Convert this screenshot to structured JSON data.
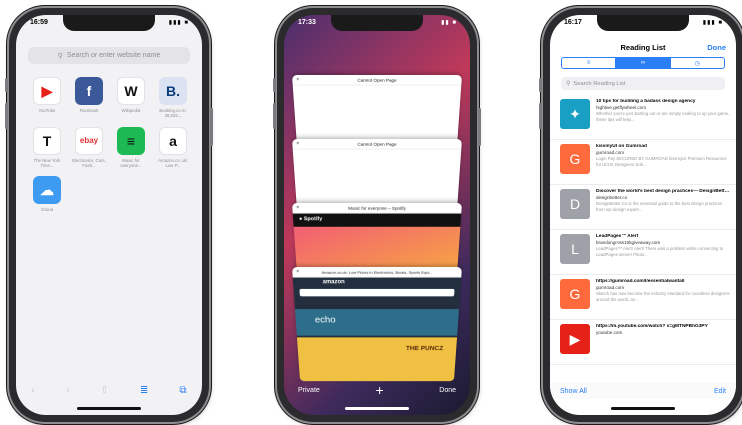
{
  "phone_favorites": {
    "time": "16:59",
    "status_icons": "▮▮▮ ■",
    "search_placeholder": "Search or enter website name",
    "favorites": [
      {
        "icon": "youtube-icon",
        "glyph": "▶",
        "bg": "#ffffff",
        "fg": "#e62117",
        "caption": "YouTube"
      },
      {
        "icon": "facebook-icon",
        "glyph": "f",
        "bg": "#3b5998",
        "fg": "#ffffff",
        "caption": "Facebook"
      },
      {
        "icon": "wikipedia-icon",
        "glyph": "W",
        "bg": "#ffffff",
        "fg": "#111111",
        "caption": "Wikipedia"
      },
      {
        "icon": "booking-icon",
        "glyph": "B.",
        "bg": "#dbe3f2",
        "fg": "#0c3b7c",
        "caption": "Booking.co m: 28,032..."
      },
      {
        "icon": "nytimes-icon",
        "glyph": "T",
        "bg": "#ffffff",
        "fg": "#111111",
        "caption": "The New York Time..."
      },
      {
        "icon": "ebay-icon",
        "glyph": "ebay",
        "bg": "#ffffff",
        "fg": "#e53238",
        "caption": "Electronics, Cars, Fash..."
      },
      {
        "icon": "spotify-icon",
        "glyph": "≡",
        "bg": "#1db954",
        "fg": "#111111",
        "caption": "Music for everyone..."
      },
      {
        "icon": "amazon-icon",
        "glyph": "a",
        "bg": "#ffffff",
        "fg": "#111111",
        "caption": "Amazon.co. uk: Low P..."
      },
      {
        "icon": "icloud-icon",
        "glyph": "☁",
        "bg": "#3d9bf2",
        "fg": "#ffffff",
        "caption": "iCloud"
      }
    ],
    "toolbar": [
      "‹",
      "›",
      "⇧",
      "≣",
      "⧉"
    ]
  },
  "phone_tabs": {
    "time": "17:33",
    "status_icons": "▮▮ ■",
    "tabs": [
      {
        "title": "Cannot Open Page",
        "close": "×",
        "body_color": "#ffffff"
      },
      {
        "title": "Cannot Open Page",
        "close": "×",
        "body_color": "#ffffff"
      },
      {
        "title": "Music for everyone – Spotify",
        "close": "×",
        "body_color": "#f25f73",
        "content": "Spotify"
      },
      {
        "title": "Amazon.co.uk: Low Prices in Electronics, Books, Sports Equi...",
        "close": "×",
        "body_color": "#232f3e",
        "content": "amazon",
        "extra": "echo",
        "extra2": "THE PUNCZ"
      }
    ],
    "private_label": "Private",
    "plus_label": "+",
    "done_label": "Done"
  },
  "phone_reading": {
    "time": "16:17",
    "status_icons": "▮▮▮ ■",
    "title": "Reading List",
    "done_label": "Done",
    "segments": [
      "≡",
      "∞",
      "◷"
    ],
    "search_placeholder": "Search Reading List",
    "items": [
      {
        "thumb_glyph": "✦",
        "thumb_bg": "#1a9fc4",
        "title": "10 tips for building a badass design agency",
        "url": "hightive.getflywheel.com",
        "desc": "Whether you're just starting out or are simply looking to up your game, these tips will help..."
      },
      {
        "thumb_glyph": "G",
        "thumb_bg": "#ff6a3d",
        "title": "kissmyUI on Gumroad",
        "url": "gumroad.com",
        "desc": "Login Pay SECURED BY GUMROAD kissmyUI Premium Resources for UI/UX Designers Sub..."
      },
      {
        "thumb_glyph": "D",
        "thumb_bg": "#9ea1a7",
        "title": "Discover the world's best design practices— DesignBetter.Co",
        "url": "designbetter.co",
        "desc": "DesignBetter.Co is the essential guide to the best design practices from top design expert..."
      },
      {
        "thumb_glyph": "L",
        "thumb_bg": "#9ea1a7",
        "title": "LeadPages™ Alert",
        "url": "brandongross10kgiveaway.com",
        "desc": "LeadPages™ Alert! Alert! There was a problem while connecting to LeadPages server! Pleas..."
      },
      {
        "thumb_glyph": "G",
        "thumb_bg": "#ff6a3d",
        "title": "https://gumroad.com/l/essentialwantall",
        "url": "gumroad.com",
        "desc": "Sketch has now become the industry standard for countless designers around the world, an..."
      },
      {
        "thumb_glyph": "▶",
        "thumb_bg": "#e62117",
        "title": "https://m.youtube.com/watch? v=gMTNPBhG3PY",
        "url": "youtube.com",
        "desc": ""
      }
    ],
    "show_all_label": "Show All",
    "edit_label": "Edit"
  }
}
